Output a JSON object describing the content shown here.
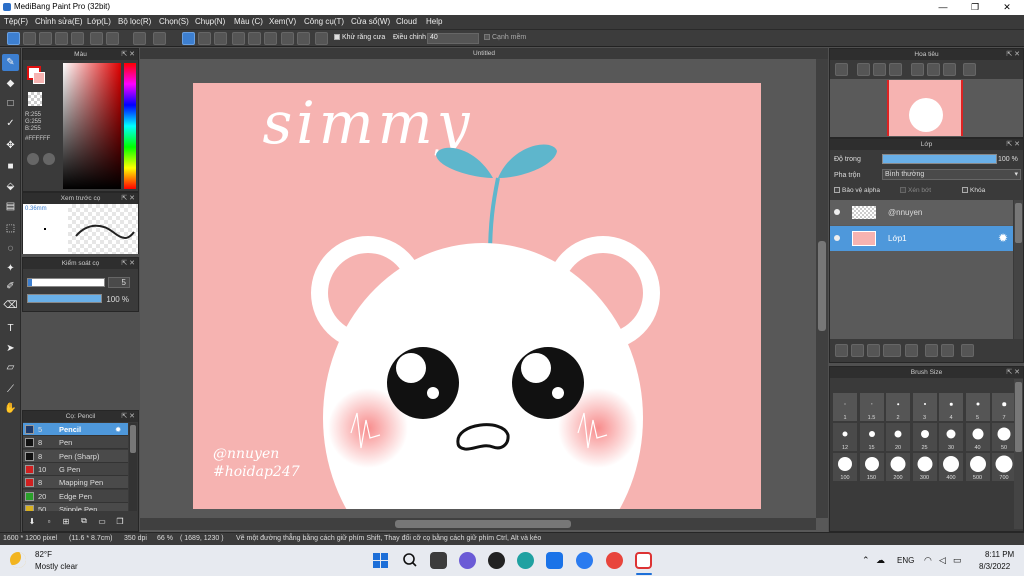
{
  "window": {
    "title": "MediBang Paint Pro (32bit)",
    "min": "—",
    "max": "❐",
    "close": "✕"
  },
  "menu": [
    "Tệp(F)",
    "Chỉnh sửa(E)",
    "Lớp(L)",
    "Bộ lọc(R)",
    "Chọn(S)",
    "Chụp(N)",
    "Màu (C)",
    "Xem(V)",
    "Công cụ(T)",
    "Cửa sổ(W)",
    "Cloud",
    "Help"
  ],
  "toolbar": {
    "antialias_label": "Khử răng cưa",
    "adjust_label": "Điều chỉnh",
    "adjust_value": "40",
    "smooth_label": "Cạnh mềm"
  },
  "color_panel": {
    "title": "Màu",
    "r": "R:255",
    "g": "G:255",
    "b": "B:255",
    "hex": "#FFFFFF",
    "primary": "#ff0000",
    "secondary": "#ffffff"
  },
  "preview_panel": {
    "title": "Xem trước cọ",
    "size": "0.36mm"
  },
  "brush_control": {
    "title": "Kiểm soát cọ",
    "size": "5",
    "opacity": "100 %"
  },
  "brush_list": {
    "title": "Cọ: Pencil",
    "items": [
      {
        "size": "5",
        "name": "Pencil",
        "color": "#1e3a6a",
        "selected": true
      },
      {
        "size": "8",
        "name": "Pen",
        "color": "#111111",
        "selected": false
      },
      {
        "size": "8",
        "name": "Pen (Sharp)",
        "color": "#111111",
        "selected": false
      },
      {
        "size": "10",
        "name": "G Pen",
        "color": "#d02020",
        "selected": false
      },
      {
        "size": "8",
        "name": "Mapping Pen",
        "color": "#d02020",
        "selected": false
      },
      {
        "size": "20",
        "name": "Edge Pen",
        "color": "#2aa02a",
        "selected": false
      },
      {
        "size": "50",
        "name": "Stipple Pen",
        "color": "#d8b020",
        "selected": false
      }
    ]
  },
  "document": {
    "tab_title": "Untitled",
    "artwork": {
      "title_script": "simmy",
      "watermark_1": "@nnuyen",
      "watermark_2": "#hoidap247"
    }
  },
  "navigator": {
    "title": "Hoa tiêu"
  },
  "layer_panel": {
    "title": "Lớp",
    "opacity_label": "Độ trong",
    "opacity_value": "100 %",
    "blend_label": "Pha trộn",
    "blend_value": "Bình thường",
    "protect_alpha": "Bảo vệ alpha",
    "clipping": "Xén bớt",
    "lock": "Khóa",
    "layers": [
      {
        "name": "@nnuyen",
        "selected": false
      },
      {
        "name": "Lớp1",
        "selected": true
      }
    ]
  },
  "brush_size": {
    "title": "Brush Size",
    "sizes": [
      "1",
      "1.5",
      "2",
      "3",
      "4",
      "5",
      "7",
      "12",
      "15",
      "20",
      "25",
      "30",
      "40",
      "50",
      "100",
      "150",
      "200",
      "300",
      "400",
      "500",
      "700"
    ]
  },
  "status": {
    "dims": "1600 * 1200 pixel",
    "physical": "(11.6 * 8.7cm)",
    "dpi": "350 dpi",
    "zoom": "66 %",
    "coords": "( 1689, 1230 )",
    "hint": "Vẽ một đường thẳng bằng cách giữ phím Shift, Thay đổi cỡ cọ bằng cách giữ phím Ctrl, Alt và kéo"
  },
  "taskbar": {
    "temp": "82°F",
    "weather": "Mostly clear",
    "lang": "ENG",
    "time": "8:11 PM",
    "date": "8/3/2022"
  }
}
